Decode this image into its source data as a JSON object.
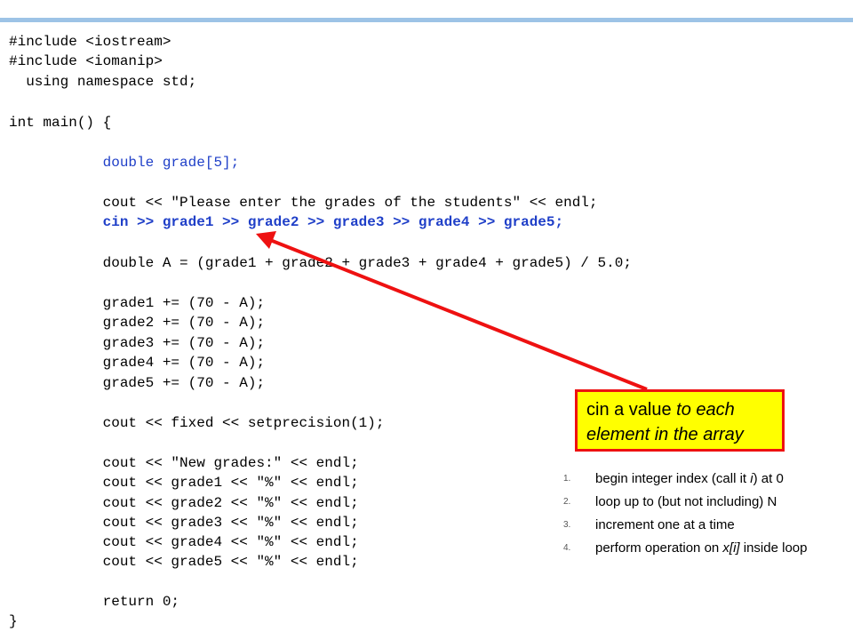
{
  "code": {
    "lines": [
      "#include <iostream>",
      "#include <iomanip>",
      "  using namespace std;",
      "",
      "int main() {",
      "",
      "           double grade[5];",
      "",
      "           cout << \"Please enter the grades of the students\" << endl;",
      "           cin >> grade1 >> grade2 >> grade3 >> grade4 >> grade5;",
      "",
      "           double A = (grade1 + grade2 + grade3 + grade4 + grade5) / 5.0;",
      "",
      "           grade1 += (70 - A);",
      "           grade2 += (70 - A);",
      "           grade3 += (70 - A);",
      "           grade4 += (70 - A);",
      "           grade5 += (70 - A);",
      "",
      "           cout << fixed << setprecision(1);",
      "",
      "           cout << \"New grades:\" << endl;",
      "           cout << grade1 << \"%\" << endl;",
      "           cout << grade2 << \"%\" << endl;",
      "           cout << grade3 << \"%\" << endl;",
      "           cout << grade4 << \"%\" << endl;",
      "           cout << grade5 << \"%\" << endl;",
      "",
      "           return 0;",
      "}"
    ]
  },
  "callout": {
    "part1": "cin a value ",
    "part2": "to each element in the array"
  },
  "steps": [
    {
      "num": "1.",
      "a": "begin integer index (call it ",
      "b": "i",
      "c": ") at 0"
    },
    {
      "num": "2.",
      "a": "loop up to (but not including) N",
      "b": "",
      "c": ""
    },
    {
      "num": "3.",
      "a": "increment one at a time",
      "b": "",
      "c": ""
    },
    {
      "num": "4.",
      "a": "perform operation on ",
      "b": "x[i]",
      "c": " inside loop"
    }
  ],
  "colors": {
    "code_blue": "#1F3FC8",
    "callout_fill": "#FFFF00",
    "callout_border": "#EE1111",
    "arrow": "#EE1111",
    "top_bar": "#9DC3E6"
  }
}
